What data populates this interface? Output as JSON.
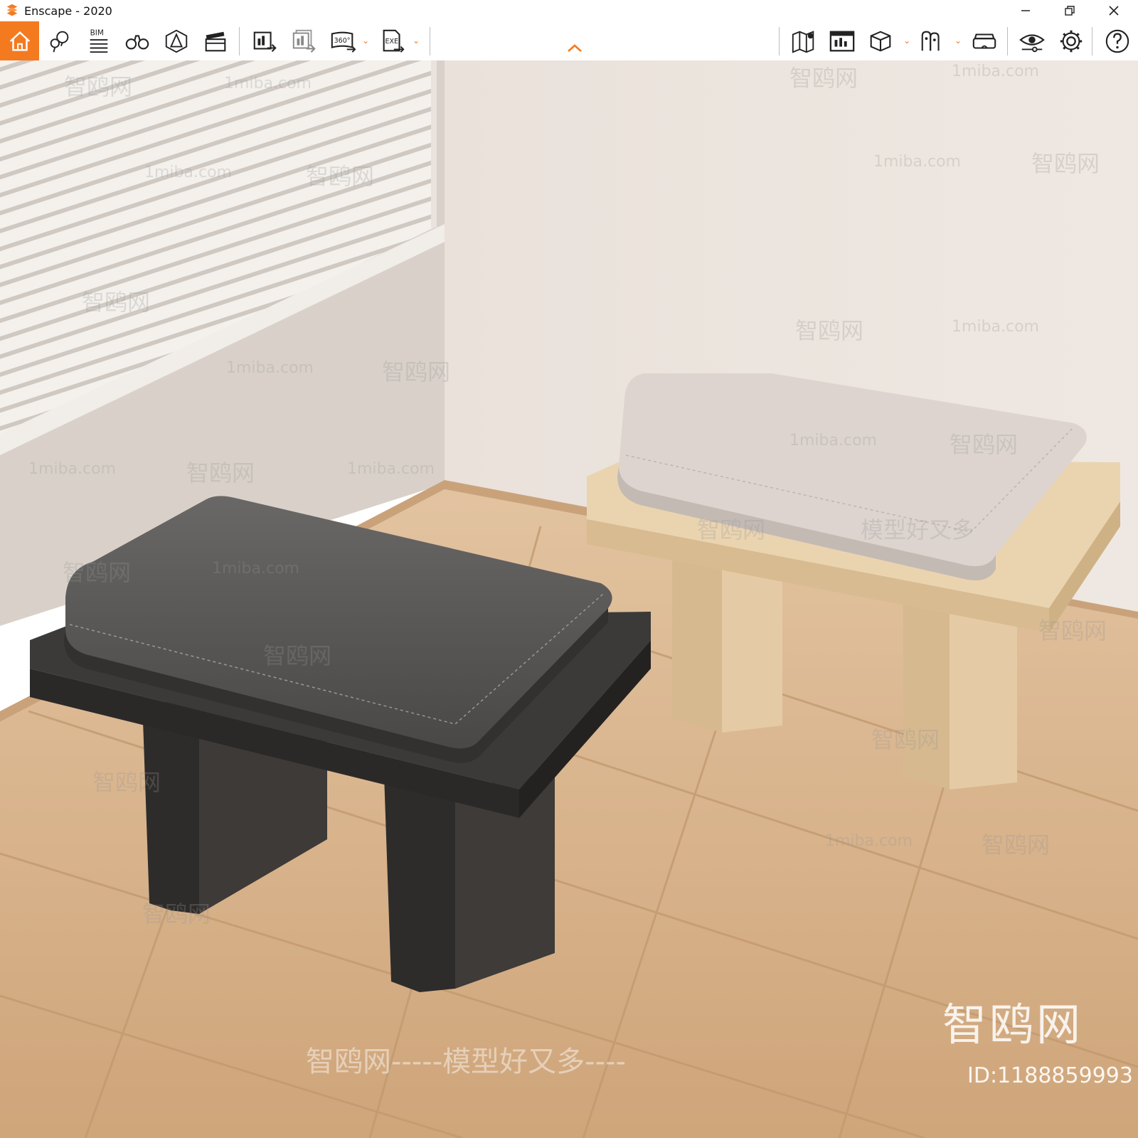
{
  "window": {
    "title": "Enscape - 2020",
    "logo_icon": "enscape-logo-icon",
    "controls": [
      "minimize-icon",
      "restore-icon",
      "close-icon"
    ]
  },
  "toolbar": {
    "left_tools": [
      {
        "name": "home",
        "icon": "home-icon",
        "active": true
      },
      {
        "name": "asset-library",
        "icon": "asset-pins-icon"
      },
      {
        "name": "bim",
        "icon": "bim-list-icon",
        "label": "BIM"
      },
      {
        "name": "views",
        "icon": "binoculars-icon"
      },
      {
        "name": "atmosphere",
        "icon": "atmosphere-icon"
      },
      {
        "name": "video-editor",
        "icon": "clapperboard-icon"
      },
      {
        "name": "screenshot",
        "icon": "screenshot-export-icon"
      },
      {
        "name": "batch-render",
        "icon": "batch-export-icon"
      },
      {
        "name": "panorama",
        "icon": "panorama-360-icon",
        "label": "360°",
        "dropdown": true
      },
      {
        "name": "exe-export",
        "icon": "exe-export-icon",
        "label": "EXE",
        "dropdown": true
      }
    ],
    "right_tools": [
      {
        "name": "map",
        "icon": "map-pin-icon"
      },
      {
        "name": "view-management",
        "icon": "view-management-icon"
      },
      {
        "name": "cube-view",
        "icon": "cube-icon",
        "dropdown": true
      },
      {
        "name": "collaboration",
        "icon": "collaboration-icon",
        "dropdown": true
      },
      {
        "name": "vr-headset",
        "icon": "vr-headset-icon"
      },
      {
        "name": "visual-settings",
        "icon": "eye-settings-icon"
      },
      {
        "name": "settings",
        "icon": "gear-icon"
      },
      {
        "name": "help",
        "icon": "help-icon"
      }
    ],
    "collapse_icon": "chevron-up-icon"
  },
  "viewport": {
    "scene": "rendered interior with two wooden stools",
    "watermarks": {
      "site": "1miba.com",
      "brand": "智鸥网",
      "slogan": "智鸥网-----模型好又多----",
      "slogan_short": "模型好又多",
      "big": "智鸥网",
      "id": "ID:1188859993"
    }
  },
  "colors": {
    "accent": "#f47a20",
    "wall": "#ece4dd",
    "floor": "#d8b48f",
    "dark_stool": "#3a3836",
    "light_stool": "#e0c8a2",
    "cushion_light": "#d8cec8"
  }
}
